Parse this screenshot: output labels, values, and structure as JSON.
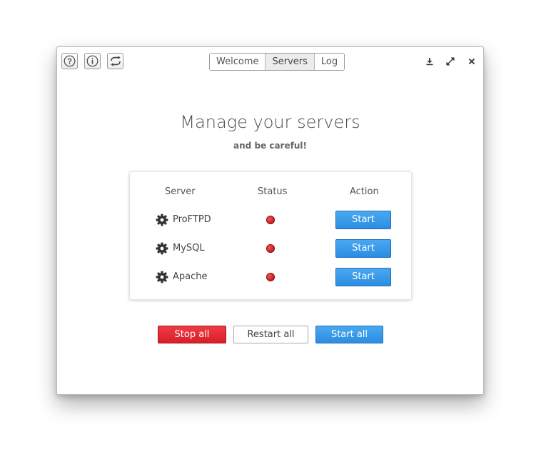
{
  "toolbar": {
    "help_icon": "question-circle-icon",
    "info_icon": "info-circle-icon",
    "refresh_icon": "sync-icon"
  },
  "tabs": [
    {
      "label": "Welcome",
      "active": false
    },
    {
      "label": "Servers",
      "active": true
    },
    {
      "label": "Log",
      "active": false
    }
  ],
  "window_controls": {
    "download_icon": "download-icon",
    "fullscreen_icon": "expand-icon",
    "close_icon": "close-icon"
  },
  "main": {
    "title": "Manage your servers",
    "subtitle": "and be careful!"
  },
  "table": {
    "headers": {
      "server": "Server",
      "status": "Status",
      "action": "Action"
    },
    "rows": [
      {
        "name": "ProFTPD",
        "status": "stopped",
        "action_label": "Start"
      },
      {
        "name": "MySQL",
        "status": "stopped",
        "action_label": "Start"
      },
      {
        "name": "Apache",
        "status": "stopped",
        "action_label": "Start"
      }
    ]
  },
  "actions": {
    "stop_all": "Stop all",
    "restart_all": "Restart all",
    "start_all": "Start all"
  },
  "colors": {
    "primary_blue": "#2c8de2",
    "danger_red": "#d81f2a",
    "status_stopped": "#c11a1a"
  }
}
